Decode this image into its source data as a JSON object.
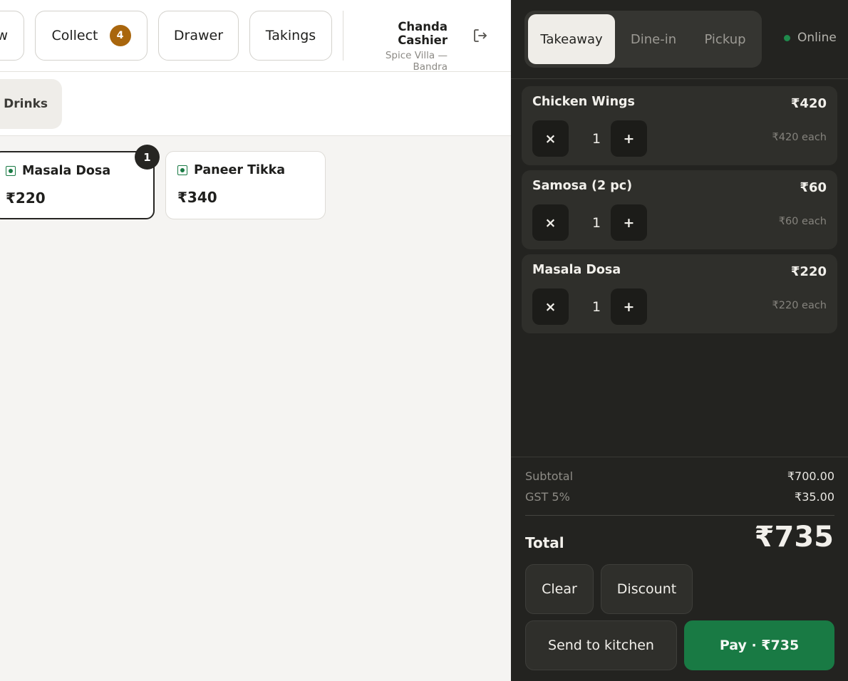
{
  "toolbar": {
    "partial_label": "w",
    "collect_label": "Collect",
    "collect_count": "4",
    "drawer_label": "Drawer",
    "takings_label": "Takings"
  },
  "user": {
    "name": "Chanda Cashier",
    "location": "Spice Villa — Bandra"
  },
  "categories": {
    "visible_partial": "& Drinks"
  },
  "menu": [
    {
      "name": "Masala Dosa",
      "price": "₹220",
      "in_cart_qty": "1",
      "veg": true
    },
    {
      "name": "Paneer Tikka",
      "price": "₹340",
      "veg": true
    }
  ],
  "order": {
    "modes": [
      "Takeaway",
      "Dine-in",
      "Pickup"
    ],
    "active_mode": "Takeaway",
    "status": "Online",
    "items": [
      {
        "name": "Chicken Wings",
        "total": "₹420",
        "qty": "1",
        "each": "₹420 each"
      },
      {
        "name": "Samosa (2 pc)",
        "total": "₹60",
        "qty": "1",
        "each": "₹60 each"
      },
      {
        "name": "Masala Dosa",
        "total": "₹220",
        "qty": "1",
        "each": "₹220 each"
      }
    ],
    "remove_symbol": "×",
    "add_symbol": "+",
    "subtotal_label": "Subtotal",
    "subtotal": "₹700.00",
    "tax_label": "GST 5%",
    "tax": "₹35.00",
    "total_label": "Total",
    "total": "₹735",
    "clear_label": "Clear",
    "discount_label": "Discount",
    "kitchen_label": "Send to kitchen",
    "pay_label": "Pay · ₹735"
  },
  "colors": {
    "accent_green": "#197a44",
    "badge_orange": "#a9660d",
    "panel_dark": "#232320"
  }
}
